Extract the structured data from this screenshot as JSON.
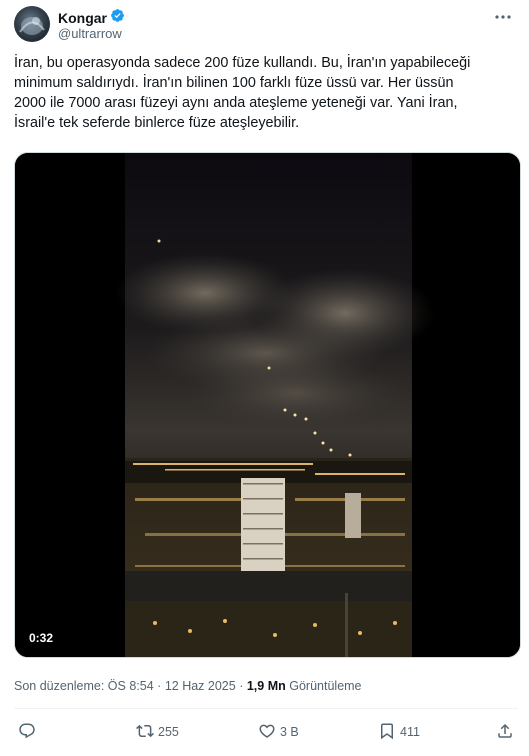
{
  "author": {
    "name": "Kongar",
    "handle": "@ultrarrow",
    "verified": true,
    "verified_color": "#1d9bf0"
  },
  "tweet": {
    "lines": [
      "İran, bu operasyonda sadece 200 füze kullandı. Bu, İran'ın yapabileceği",
      "minimum saldırıydı. İran'ın bilinen 100 farklı füze üssü var. Her üssün",
      "2000 ile 7000 arası füzeyi aynı anda ateşleme yeteneği var. Yani İran,",
      "İsrail'e tek seferde binlerce füze ateşleyebilir."
    ]
  },
  "media": {
    "type": "video",
    "duration": "0:32"
  },
  "meta": {
    "edited": "Son düzenleme: ÖS 8:54",
    "separator": "·",
    "date": "12 Haz 2025",
    "views_count": "1,9 Mn",
    "views_label": "Görüntüleme"
  },
  "actions": {
    "reply": {
      "icon": "reply-icon",
      "count": ""
    },
    "repost": {
      "icon": "repost-icon",
      "count": "255"
    },
    "like": {
      "icon": "heart-icon",
      "count": "3 B"
    },
    "bookmark": {
      "icon": "bookmark-icon",
      "count": "411"
    },
    "share": {
      "icon": "share-icon",
      "count": ""
    }
  },
  "colors": {
    "text": "#0f1419",
    "secondary": "#536471",
    "accent": "#1d9bf0"
  }
}
